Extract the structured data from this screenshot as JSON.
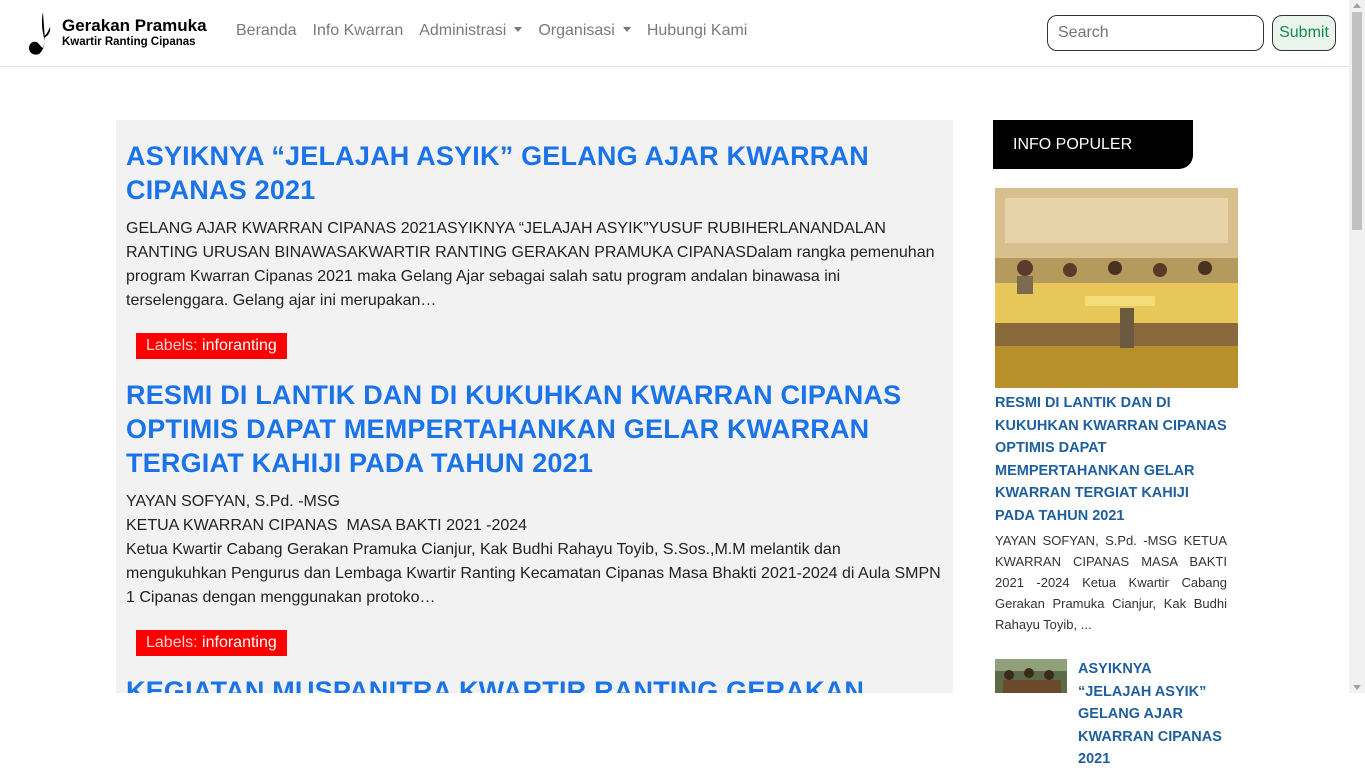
{
  "brand": {
    "title": "Gerakan Pramuka",
    "subtitle": "Kwartir Ranting Cipanas"
  },
  "nav": {
    "home": "Beranda",
    "info": "Info Kwarran",
    "admin": "Administrasi",
    "org": "Organisasi",
    "contact": "Hubungi Kami"
  },
  "search": {
    "placeholder": "Search",
    "submit_label": "Submit"
  },
  "posts": [
    {
      "title": "ASYIKNYA “JELAJAH ASYIK” GELANG AJAR KWARRAN CIPANAS 2021",
      "excerpt": "GELANG AJAR KWARRAN CIPANAS 2021ASYIKNYA “JELAJAH ASYIK”YUSUF RUBIHERLANANDALAN RANTING URUSAN BINAWASAKWARTIR RANTING GERAKAN PRAMUKA CIPANASDalam rangka pemenuhan program Kwarran Cipanas 2021 maka Gelang Ajar sebagai salah satu program andalan binawasa ini terselenggara. Gelang ajar ini merupakan…",
      "label_prefix": "Labels:",
      "label": "inforanting"
    },
    {
      "title": "RESMI DI LANTIK DAN DI KUKUHKAN KWARRAN CIPANAS OPTIMIS DAPAT MEMPERTAHANKAN GELAR KWARRAN TERGIAT KAHIJI PADA TAHUN 2021",
      "excerpt_line1": "YAYAN SOFYAN, S.Pd. -MSG",
      "excerpt_line2": "KETUA KWARRAN CIPANAS  MASA BAKTI 2021 -2024",
      "excerpt_line3": "Ketua Kwartir Cabang Gerakan Pramuka Cianjur, Kak Budhi Rahayu Toyib, S.Sos.,M.M melantik dan mengukuhkan Pengurus dan Lembaga Kwartir Ranting Kecamatan Cipanas Masa Bhakti 2021-2024 di Aula SMPN 1 Cipanas dengan menggunakan protoko…",
      "label_prefix": "Labels:",
      "label": "inforanting"
    },
    {
      "title": "KEGIATAN MUSPANITRA KWARTIR RANTING GERAKAN"
    }
  ],
  "sidebar": {
    "header": "INFO POPULER",
    "popular": [
      {
        "title": "RESMI DI LANTIK DAN DI KUKUHKAN KWARRAN CIPANAS OPTIMIS DAPAT MEMPERTAHANKAN GELAR KWARRAN TERGIAT KAHIJI PADA TAHUN 2021",
        "excerpt": "YAYAN SOFYAN, S.Pd. -MSG KETUA KWARRAN CIPANAS MASA BAKTI 2021 -2024 Ketua Kwartir Cabang Gerakan Pramuka Cianjur, Kak Budhi Rahayu Toyib, ..."
      },
      {
        "title": "ASYIKNYA “JELAJAH ASYIK” GELANG AJAR KWARRAN CIPANAS 2021"
      }
    ]
  },
  "colors": {
    "post_title": "#1a73e8",
    "label_bg": "#ff0000",
    "sidebar_title": "#1f5f9e",
    "submit_text": "#198754"
  }
}
